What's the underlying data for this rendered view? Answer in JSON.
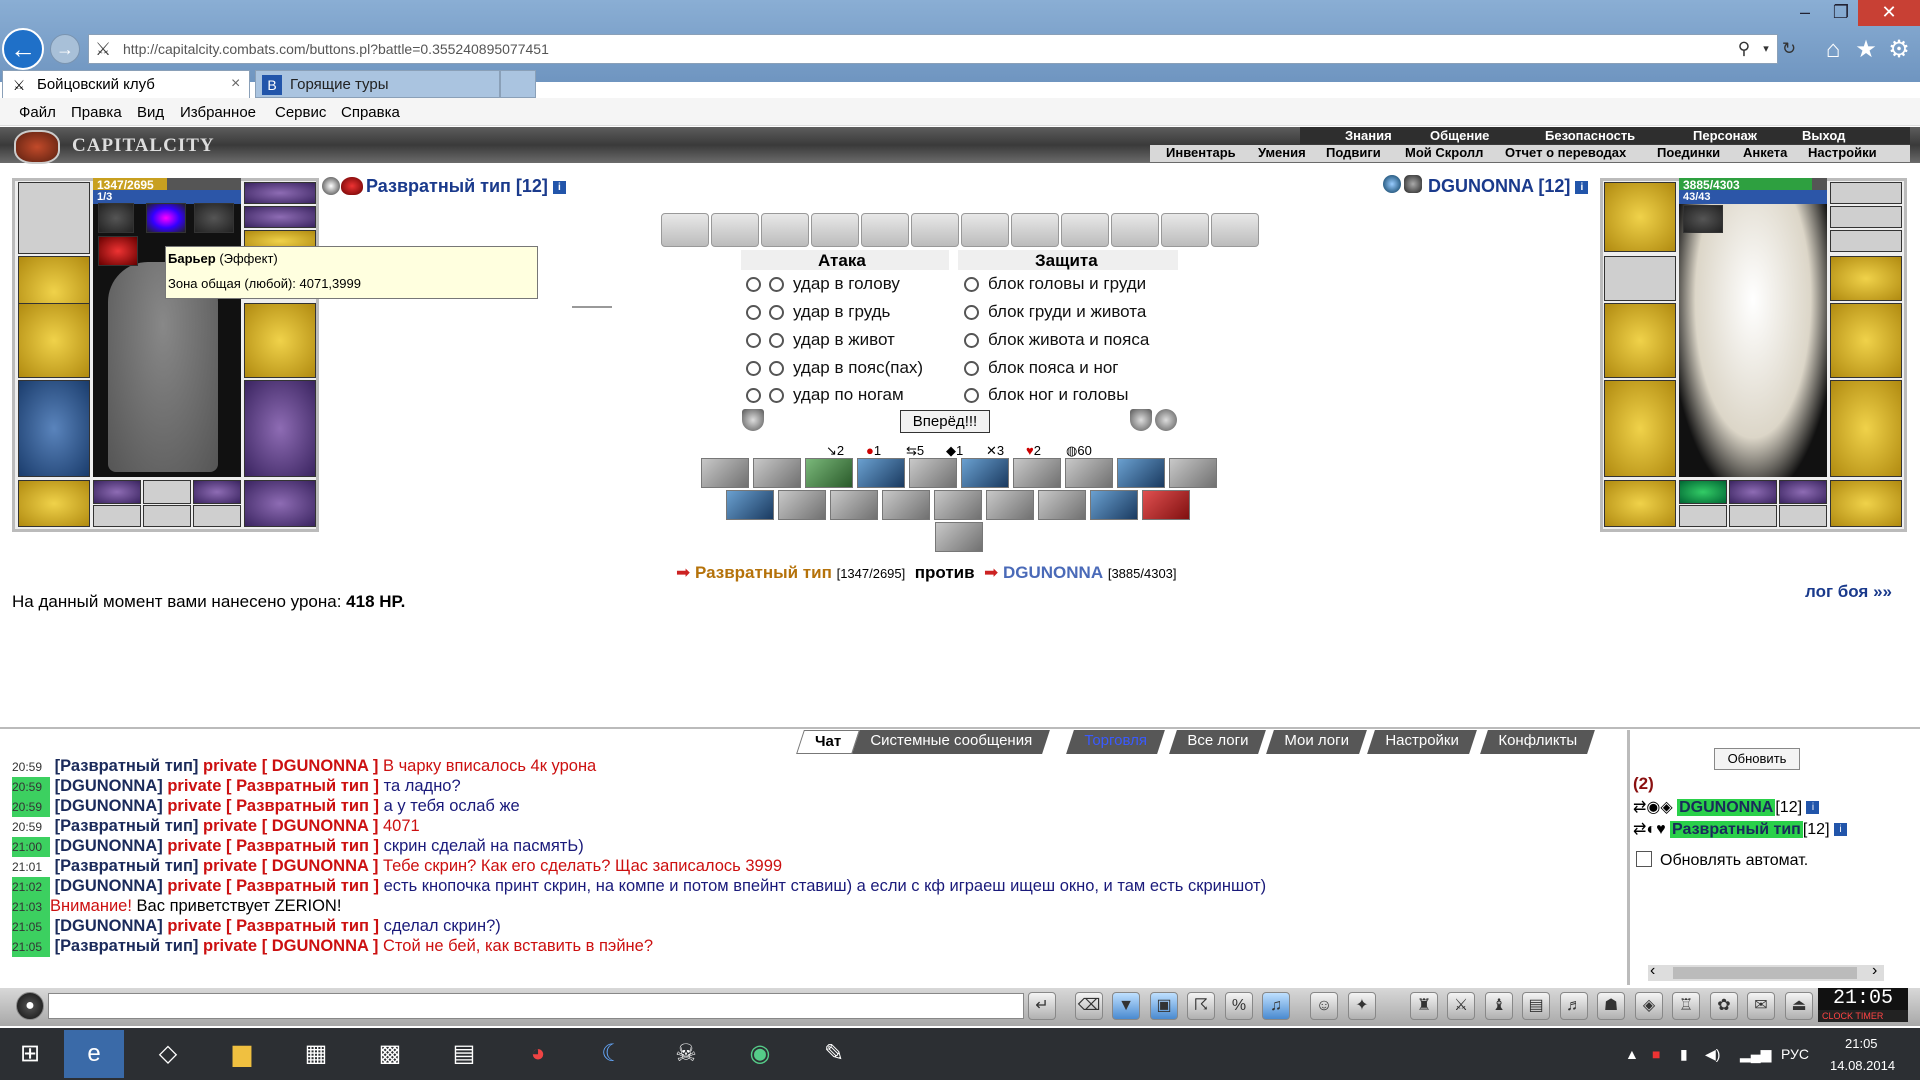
{
  "browser": {
    "url": "http://capitalcity.combats.com/buttons.pl?battle=0.355240895077451",
    "tabs": [
      {
        "label": "Бойцовский клуб"
      },
      {
        "label": "Горящие туры"
      }
    ],
    "menu": [
      "Файл",
      "Правка",
      "Вид",
      "Избранное",
      "Сервис",
      "Справка"
    ]
  },
  "game": {
    "logo": "CAPITALCITY",
    "nav_top": [
      "Знания",
      "Общение",
      "Безопасность",
      "Персонаж",
      "Выход"
    ],
    "nav_bottom": [
      "Инвентарь",
      "Умения",
      "Подвиги",
      "Мой Скролл",
      "Отчет о переводах",
      "Поединки",
      "Анкета",
      "Настройки"
    ],
    "player": {
      "name": "Развратный тип [12]",
      "hp": "1347/2695",
      "mana": "1/3"
    },
    "opponent": {
      "name": "DGUNONNA [12]",
      "hp": "3885/4303",
      "mana": "43/43"
    },
    "tooltip": {
      "title": "Барьер",
      "subtitle": "(Эффект)",
      "line": "Зона общая (любой): 4071,3999"
    },
    "attack": {
      "header": "Атака",
      "options": [
        "удар в голову",
        "удар в грудь",
        "удар в живот",
        "удар в пояс(пах)",
        "удар по ногам"
      ]
    },
    "defense": {
      "header": "Защита",
      "options": [
        "блок головы и груди",
        "блок груди и живота",
        "блок живота и пояса",
        "блок пояса и ног",
        "блок ног и головы"
      ]
    },
    "go_button": "Вперёд!!!",
    "stats": [
      "2",
      "1",
      "5",
      "1",
      "3",
      "2",
      "60"
    ],
    "vs": {
      "player_name": "Развратный тип",
      "player_hp": "[1347/2695]",
      "word": "против",
      "opponent_name": "DGUNONNA",
      "opponent_hp": "[3885/4303]"
    },
    "damage_text": "На данный момент вами нанесено урона:",
    "damage_value": "418 HP.",
    "battle_log_link": "лог боя »»"
  },
  "chat": {
    "tabs": [
      "Чат",
      "Системные сообщения",
      "Торговля",
      "Все логи",
      "Мои логи",
      "Настройки",
      "Конфликты"
    ],
    "messages": [
      {
        "time": "20:59",
        "hl": false,
        "nick": "[Развратный тип]",
        "priv": "private [ DGUNONNA ]",
        "text": "В чарку вписалось 4к урона"
      },
      {
        "time": "20:59",
        "hl": true,
        "nick": "[DGUNONNA]",
        "priv": "private [ Развратный тип ]",
        "text": "та ладно?"
      },
      {
        "time": "20:59",
        "hl": true,
        "nick": "[DGUNONNA]",
        "priv": "private [ Развратный тип ]",
        "text": "а у тебя ослаб же"
      },
      {
        "time": "20:59",
        "hl": false,
        "nick": "[Развратный тип]",
        "priv": "private [ DGUNONNA ]",
        "text": "4071"
      },
      {
        "time": "21:00",
        "hl": true,
        "nick": "[DGUNONNA]",
        "priv": "private [ Развратный тип ]",
        "text": "скрин сделай на пасмятЬ)"
      },
      {
        "time": "21:01",
        "hl": false,
        "nick": "[Развратный тип]",
        "priv": "private [ DGUNONNA ]",
        "text": "Тебе скрин? Как его сделать? Щас записалось 3999"
      },
      {
        "time": "21:02",
        "hl": true,
        "nick": "[DGUNONNA]",
        "priv": "private [ Развратный тип ]",
        "text": "есть кнопочка принт скрин, на компе и потом впейнт ставиш) а если с кф играеш ищеш окно, и там есть скриншот)"
      },
      {
        "time": "21:03",
        "hl": true,
        "nick": "",
        "priv": "Внимание!",
        "text": "Вас приветствует ZERION!"
      },
      {
        "time": "21:05",
        "hl": true,
        "nick": "[DGUNONNA]",
        "priv": "private [ Развратный тип ]",
        "text": "сделал скрин?)"
      },
      {
        "time": "21:05",
        "hl": false,
        "nick": "[Развратный тип]",
        "priv": "private [ DGUNONNA ]",
        "text": "Стой не бей, как вставить в пэйне?"
      }
    ],
    "refresh_button": "Обновить",
    "online_count": "(2)",
    "online": [
      {
        "name": "DGUNONNA",
        "level": "[12]"
      },
      {
        "name": "Развратный тип",
        "level": "[12]"
      }
    ],
    "auto_refresh_label": "Обновлять автомат."
  },
  "clock": {
    "time": "21:05",
    "sub": "CLOCK TIMER"
  },
  "taskbar": {
    "lang": "РУС",
    "time": "21:05",
    "date": "14.08.2014"
  }
}
